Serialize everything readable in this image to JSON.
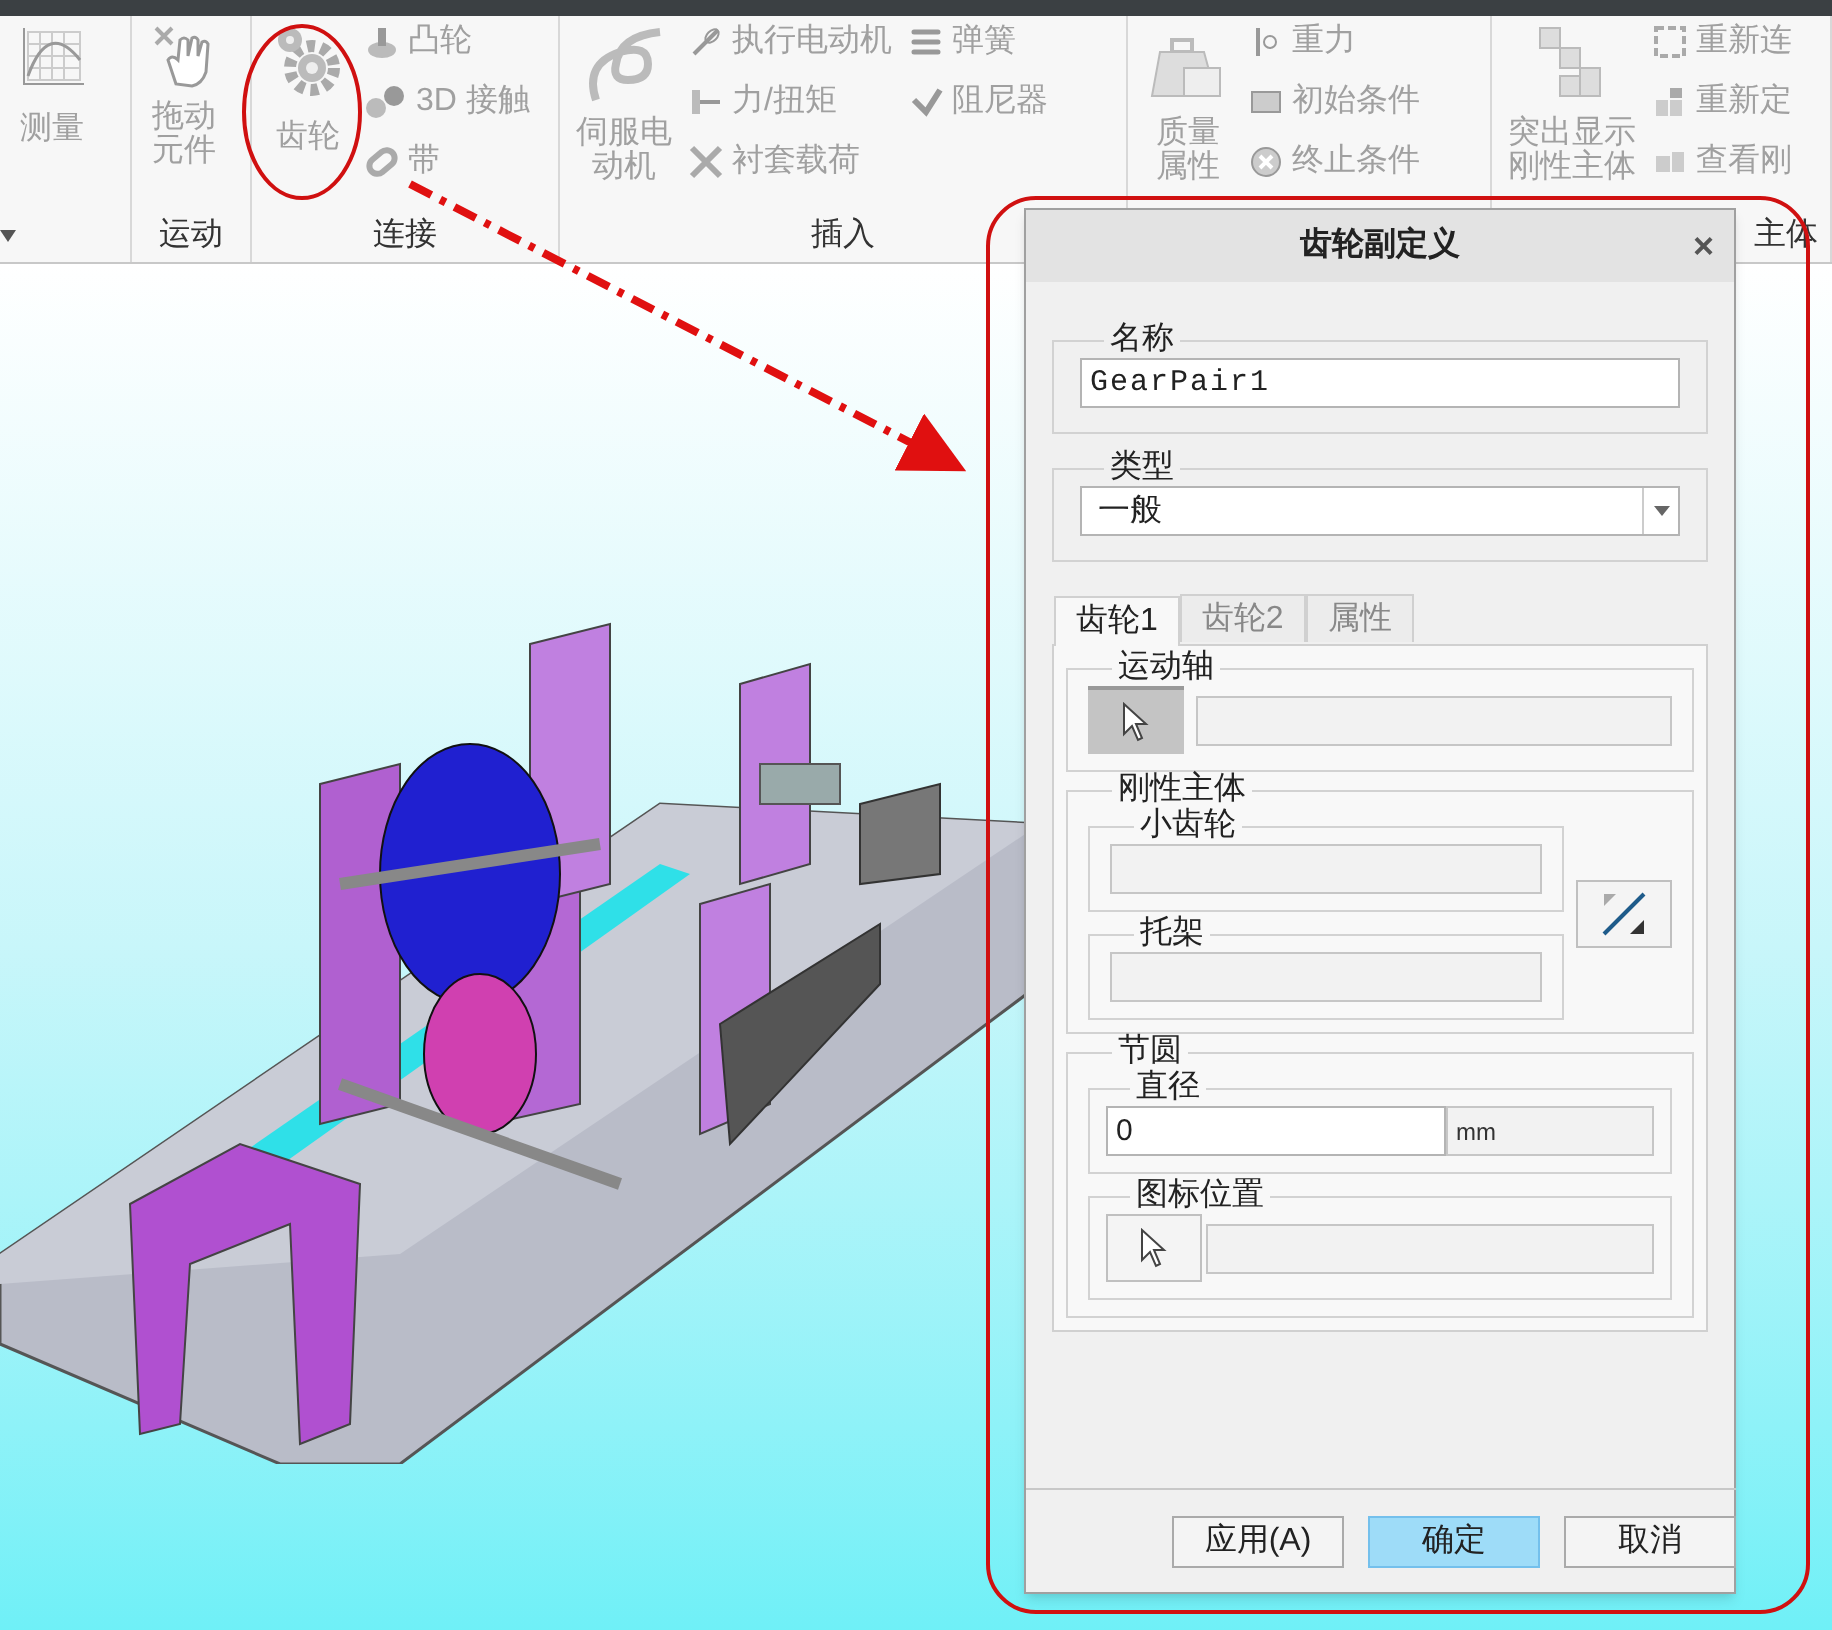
{
  "ribbon": {
    "groups": [
      {
        "columns": [
          [
            {
              "label": "测量",
              "kind": "large"
            }
          ]
        ]
      },
      {
        "label": "运动",
        "columns": [
          [
            {
              "label": "拖动元件",
              "kind": "large"
            }
          ]
        ]
      },
      {
        "label": "连接",
        "columns": [
          [
            {
              "label": "齿轮",
              "kind": "large"
            }
          ],
          [
            {
              "label": "凸轮",
              "kind": "small"
            },
            {
              "label": "3D 接触",
              "kind": "small"
            },
            {
              "label": "带",
              "kind": "small"
            }
          ]
        ]
      },
      {
        "label": "插入",
        "columns": [
          [
            {
              "label": "伺服电动机",
              "kind": "large"
            }
          ],
          [
            {
              "label": "执行电动机",
              "kind": "small"
            },
            {
              "label": "力/扭矩",
              "kind": "small"
            },
            {
              "label": "衬套载荷",
              "kind": "small"
            }
          ],
          [
            {
              "label": "弹簧",
              "kind": "small"
            },
            {
              "label": "阻尼器",
              "kind": "small"
            }
          ]
        ]
      },
      {
        "columns": [
          [
            {
              "label": "质量属性",
              "kind": "large"
            }
          ],
          [
            {
              "label": "重力",
              "kind": "small"
            },
            {
              "label": "初始条件",
              "kind": "small"
            },
            {
              "label": "终止条件",
              "kind": "small"
            }
          ]
        ]
      },
      {
        "label": "主体",
        "columns": [
          [
            {
              "label": "突出显示刚性主体",
              "kind": "large"
            }
          ],
          [
            {
              "label": "重新连",
              "kind": "small"
            },
            {
              "label": "重新定",
              "kind": "small"
            },
            {
              "label": "查看刚",
              "kind": "small"
            }
          ]
        ]
      }
    ]
  },
  "dialog": {
    "title": "齿轮副定义",
    "close": "×",
    "name": {
      "legend": "名称",
      "value": "GearPair1"
    },
    "type": {
      "legend": "类型",
      "value": "一般"
    },
    "tabs": [
      {
        "label": "齿轮1",
        "selected": true
      },
      {
        "label": "齿轮2",
        "selected": false
      },
      {
        "label": "属性",
        "selected": false
      }
    ],
    "motion_axis": {
      "legend": "运动轴",
      "pressed": true
    },
    "rigid_bodies": {
      "legend": "刚性主体",
      "pinion": "小齿轮",
      "carrier": "托架"
    },
    "pitch_circle": {
      "legend": "节圆",
      "diameter": {
        "legend": "直径",
        "value": "0",
        "unit": "mm"
      },
      "icon_position": {
        "legend": "图标位置",
        "pressed": false
      }
    },
    "buttons": [
      {
        "label": "应用(A)",
        "default": false
      },
      {
        "label": "确定",
        "default": true
      },
      {
        "label": "取消",
        "default": false
      }
    ]
  }
}
